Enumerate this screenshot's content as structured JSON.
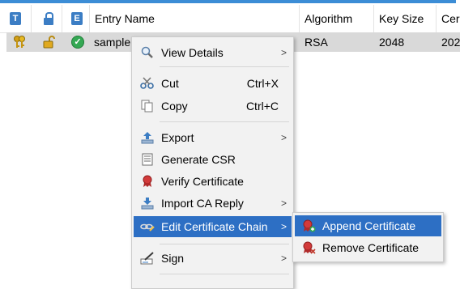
{
  "columns": {
    "type_icon_letter": "T",
    "entry_icon_letter": "E",
    "entry_name": "Entry Name",
    "algorithm": "Algorithm",
    "key_size": "Key Size",
    "cert": "Cer"
  },
  "row": {
    "name": "sample",
    "algorithm": "RSA",
    "key_size": "2048",
    "cert": "202"
  },
  "context_menu": {
    "items": [
      {
        "label": "View Details",
        "icon": "magnifier-icon",
        "shortcut": "",
        "submenu": true
      },
      {
        "label": "Cut",
        "icon": "scissors-icon",
        "shortcut": "Ctrl+X",
        "submenu": false
      },
      {
        "label": "Copy",
        "icon": "copy-icon",
        "shortcut": "Ctrl+C",
        "submenu": false
      },
      {
        "label": "Export",
        "icon": "export-icon",
        "shortcut": "",
        "submenu": true
      },
      {
        "label": "Generate CSR",
        "icon": "csr-icon",
        "shortcut": "",
        "submenu": false
      },
      {
        "label": "Verify Certificate",
        "icon": "certificate-seal-icon",
        "shortcut": "",
        "submenu": false
      },
      {
        "label": "Import CA Reply",
        "icon": "import-icon",
        "shortcut": "",
        "submenu": true
      },
      {
        "label": "Edit Certificate Chain",
        "icon": "chain-edit-icon",
        "shortcut": "",
        "submenu": true,
        "highlighted": true
      },
      {
        "label": "Sign",
        "icon": "sign-pen-icon",
        "shortcut": "",
        "submenu": true
      }
    ]
  },
  "submenu": {
    "items": [
      {
        "label": "Append Certificate",
        "icon": "append-certificate-icon",
        "highlighted": true
      },
      {
        "label": "Remove Certificate",
        "icon": "remove-certificate-icon",
        "highlighted": false
      }
    ]
  },
  "colors": {
    "accent": "#3c8dd6",
    "highlight": "#2d6fc4",
    "menu_bg": "#f2f2f2",
    "row_selected": "#d9d9d9"
  }
}
